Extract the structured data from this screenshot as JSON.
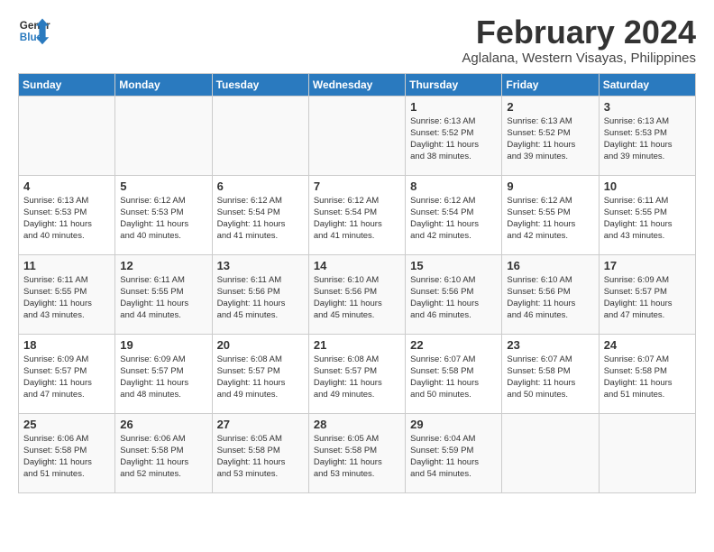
{
  "header": {
    "logo_line1": "General",
    "logo_line2": "Blue",
    "month_year": "February 2024",
    "location": "Aglalana, Western Visayas, Philippines"
  },
  "days_of_week": [
    "Sunday",
    "Monday",
    "Tuesday",
    "Wednesday",
    "Thursday",
    "Friday",
    "Saturday"
  ],
  "weeks": [
    [
      {
        "num": "",
        "info": ""
      },
      {
        "num": "",
        "info": ""
      },
      {
        "num": "",
        "info": ""
      },
      {
        "num": "",
        "info": ""
      },
      {
        "num": "1",
        "info": "Sunrise: 6:13 AM\nSunset: 5:52 PM\nDaylight: 11 hours\nand 38 minutes."
      },
      {
        "num": "2",
        "info": "Sunrise: 6:13 AM\nSunset: 5:52 PM\nDaylight: 11 hours\nand 39 minutes."
      },
      {
        "num": "3",
        "info": "Sunrise: 6:13 AM\nSunset: 5:53 PM\nDaylight: 11 hours\nand 39 minutes."
      }
    ],
    [
      {
        "num": "4",
        "info": "Sunrise: 6:13 AM\nSunset: 5:53 PM\nDaylight: 11 hours\nand 40 minutes."
      },
      {
        "num": "5",
        "info": "Sunrise: 6:12 AM\nSunset: 5:53 PM\nDaylight: 11 hours\nand 40 minutes."
      },
      {
        "num": "6",
        "info": "Sunrise: 6:12 AM\nSunset: 5:54 PM\nDaylight: 11 hours\nand 41 minutes."
      },
      {
        "num": "7",
        "info": "Sunrise: 6:12 AM\nSunset: 5:54 PM\nDaylight: 11 hours\nand 41 minutes."
      },
      {
        "num": "8",
        "info": "Sunrise: 6:12 AM\nSunset: 5:54 PM\nDaylight: 11 hours\nand 42 minutes."
      },
      {
        "num": "9",
        "info": "Sunrise: 6:12 AM\nSunset: 5:55 PM\nDaylight: 11 hours\nand 42 minutes."
      },
      {
        "num": "10",
        "info": "Sunrise: 6:11 AM\nSunset: 5:55 PM\nDaylight: 11 hours\nand 43 minutes."
      }
    ],
    [
      {
        "num": "11",
        "info": "Sunrise: 6:11 AM\nSunset: 5:55 PM\nDaylight: 11 hours\nand 43 minutes."
      },
      {
        "num": "12",
        "info": "Sunrise: 6:11 AM\nSunset: 5:55 PM\nDaylight: 11 hours\nand 44 minutes."
      },
      {
        "num": "13",
        "info": "Sunrise: 6:11 AM\nSunset: 5:56 PM\nDaylight: 11 hours\nand 45 minutes."
      },
      {
        "num": "14",
        "info": "Sunrise: 6:10 AM\nSunset: 5:56 PM\nDaylight: 11 hours\nand 45 minutes."
      },
      {
        "num": "15",
        "info": "Sunrise: 6:10 AM\nSunset: 5:56 PM\nDaylight: 11 hours\nand 46 minutes."
      },
      {
        "num": "16",
        "info": "Sunrise: 6:10 AM\nSunset: 5:56 PM\nDaylight: 11 hours\nand 46 minutes."
      },
      {
        "num": "17",
        "info": "Sunrise: 6:09 AM\nSunset: 5:57 PM\nDaylight: 11 hours\nand 47 minutes."
      }
    ],
    [
      {
        "num": "18",
        "info": "Sunrise: 6:09 AM\nSunset: 5:57 PM\nDaylight: 11 hours\nand 47 minutes."
      },
      {
        "num": "19",
        "info": "Sunrise: 6:09 AM\nSunset: 5:57 PM\nDaylight: 11 hours\nand 48 minutes."
      },
      {
        "num": "20",
        "info": "Sunrise: 6:08 AM\nSunset: 5:57 PM\nDaylight: 11 hours\nand 49 minutes."
      },
      {
        "num": "21",
        "info": "Sunrise: 6:08 AM\nSunset: 5:57 PM\nDaylight: 11 hours\nand 49 minutes."
      },
      {
        "num": "22",
        "info": "Sunrise: 6:07 AM\nSunset: 5:58 PM\nDaylight: 11 hours\nand 50 minutes."
      },
      {
        "num": "23",
        "info": "Sunrise: 6:07 AM\nSunset: 5:58 PM\nDaylight: 11 hours\nand 50 minutes."
      },
      {
        "num": "24",
        "info": "Sunrise: 6:07 AM\nSunset: 5:58 PM\nDaylight: 11 hours\nand 51 minutes."
      }
    ],
    [
      {
        "num": "25",
        "info": "Sunrise: 6:06 AM\nSunset: 5:58 PM\nDaylight: 11 hours\nand 51 minutes."
      },
      {
        "num": "26",
        "info": "Sunrise: 6:06 AM\nSunset: 5:58 PM\nDaylight: 11 hours\nand 52 minutes."
      },
      {
        "num": "27",
        "info": "Sunrise: 6:05 AM\nSunset: 5:58 PM\nDaylight: 11 hours\nand 53 minutes."
      },
      {
        "num": "28",
        "info": "Sunrise: 6:05 AM\nSunset: 5:58 PM\nDaylight: 11 hours\nand 53 minutes."
      },
      {
        "num": "29",
        "info": "Sunrise: 6:04 AM\nSunset: 5:59 PM\nDaylight: 11 hours\nand 54 minutes."
      },
      {
        "num": "",
        "info": ""
      },
      {
        "num": "",
        "info": ""
      }
    ]
  ]
}
